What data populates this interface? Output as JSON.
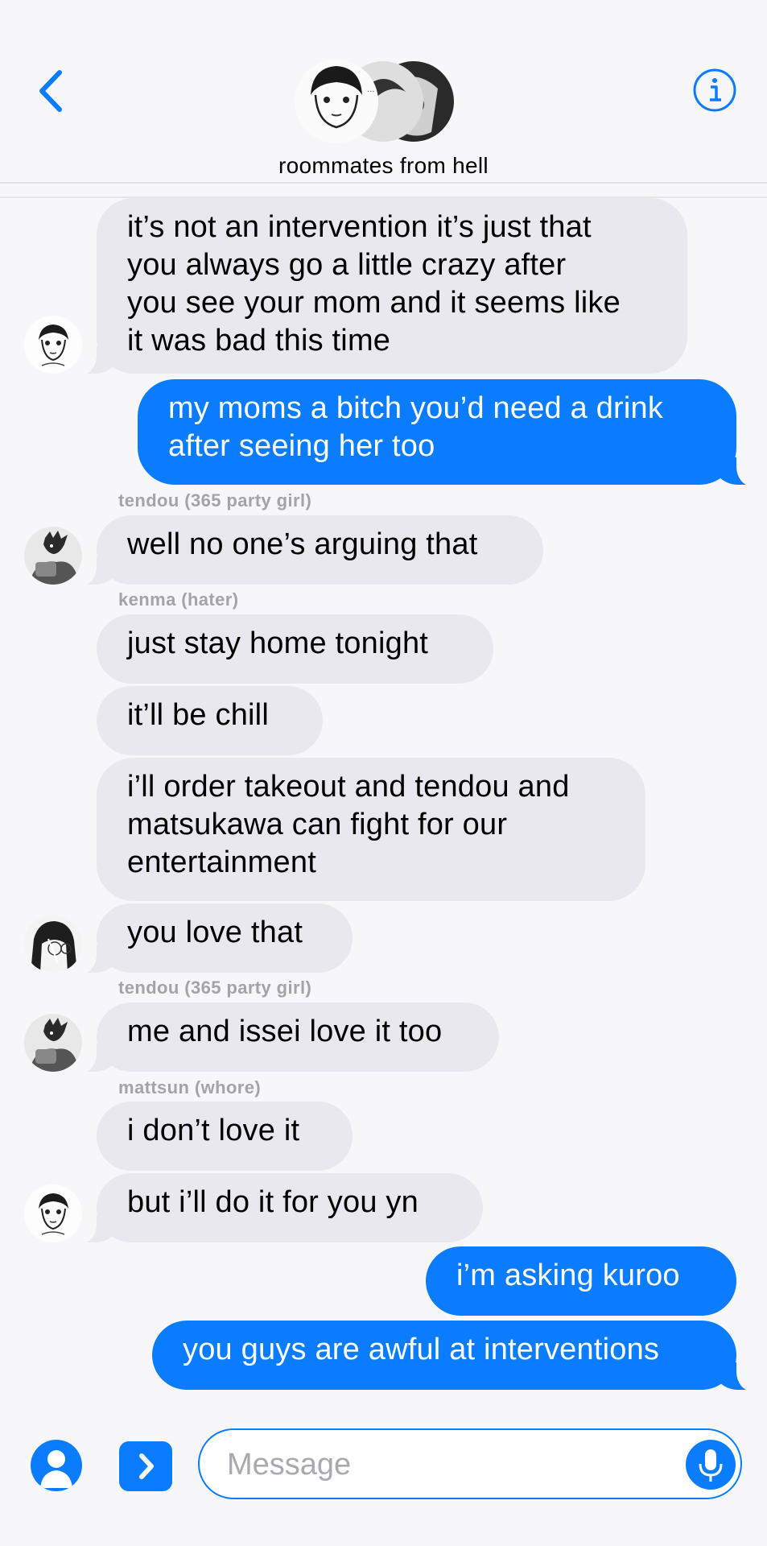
{
  "header": {
    "title": "roommates from hell"
  },
  "messages": [
    {
      "text_lines": [
        "it’s not an intervention it’s just that",
        "you always go a little crazy after",
        "you see your mom and it seems like",
        "it was bad this time"
      ]
    },
    {
      "text_lines": [
        "my moms a bitch you’d need a drink",
        "after seeing her too"
      ]
    },
    {
      "sender": "tendou (365 party girl)",
      "text": "well no one’s arguing that"
    },
    {
      "sender": "kenma (hater)",
      "text": "just stay home tonight"
    },
    {
      "text": "it’ll be chill"
    },
    {
      "text_lines": [
        "i’ll order takeout and tendou and",
        "matsukawa can fight for our",
        "entertainment"
      ]
    },
    {
      "text": "you love that"
    },
    {
      "sender": "tendou (365 party girl)",
      "text": "me and issei love it too"
    },
    {
      "sender": "mattsun (whore)",
      "text": "i don’t love it"
    },
    {
      "text": "but i’ll do it for you yn"
    },
    {
      "text": "i’m asking kuroo"
    },
    {
      "text": "you guys are awful at interventions"
    }
  ],
  "composer": {
    "placeholder": "Message"
  },
  "colors": {
    "accent": "#0a7cff",
    "incoming_bubble": "#e9e8ee",
    "sender_label": "#a3a3a8"
  }
}
